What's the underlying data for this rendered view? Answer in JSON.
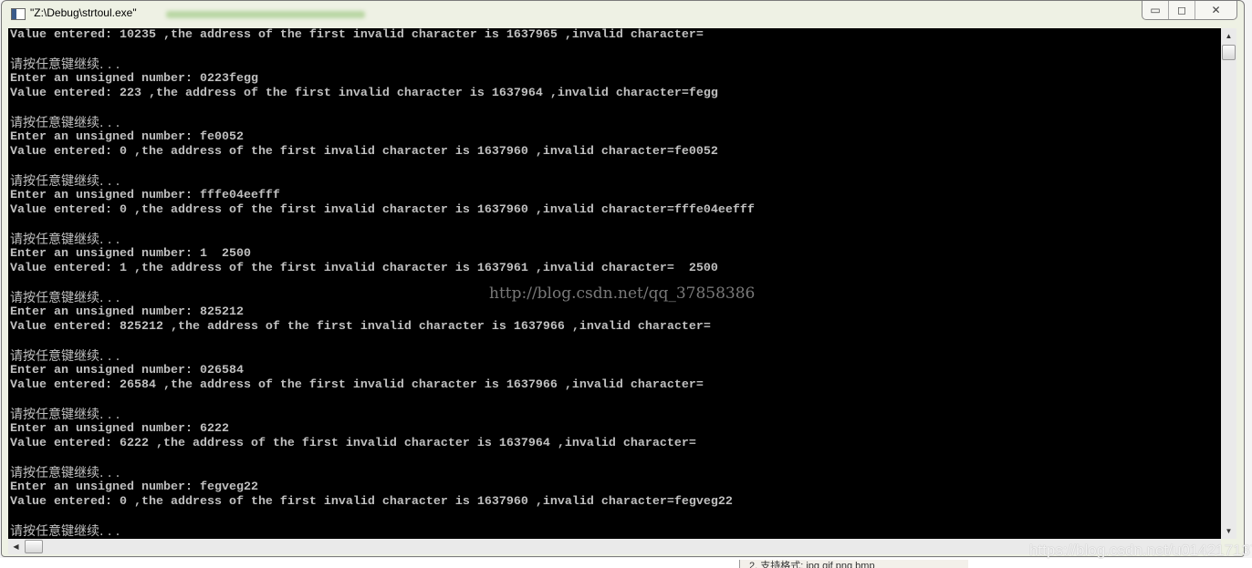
{
  "window": {
    "title": "\"Z:\\Debug\\strtoul.exe\""
  },
  "controls": {
    "minimize": "▭",
    "maximize": "◻",
    "close": "✕"
  },
  "console": {
    "lines": [
      "Value entered: 10235 ,the address of the first invalid character is 1637965 ,invalid character=",
      "",
      "请按任意键继续. . .",
      "Enter an unsigned number: 0223fegg",
      "Value entered: 223 ,the address of the first invalid character is 1637964 ,invalid character=fegg",
      "",
      "请按任意键继续. . .",
      "Enter an unsigned number: fe0052",
      "Value entered: 0 ,the address of the first invalid character is 1637960 ,invalid character=fe0052",
      "",
      "请按任意键继续. . .",
      "Enter an unsigned number: fffe04eefff",
      "Value entered: 0 ,the address of the first invalid character is 1637960 ,invalid character=fffe04eefff",
      "",
      "请按任意键继续. . .",
      "Enter an unsigned number: 1  2500",
      "Value entered: 1 ,the address of the first invalid character is 1637961 ,invalid character=  2500",
      "",
      "请按任意键继续. . .",
      "Enter an unsigned number: 825212",
      "Value entered: 825212 ,the address of the first invalid character is 1637966 ,invalid character=",
      "",
      "请按任意键继续. . .",
      "Enter an unsigned number: 026584",
      "Value entered: 26584 ,the address of the first invalid character is 1637966 ,invalid character=",
      "",
      "请按任意键继续. . .",
      "Enter an unsigned number: 6222",
      "Value entered: 6222 ,the address of the first invalid character is 1637964 ,invalid character=",
      "",
      "请按任意键继续. . .",
      "Enter an unsigned number: fegveg22",
      "Value entered: 0 ,the address of the first invalid character is 1637960 ,invalid character=fegveg22",
      "",
      "请按任意键继续. . ."
    ]
  },
  "watermarks": {
    "center": "http://blog.csdn.net/qq_37858386",
    "corner": "https://blog.csdn.net/u014217137"
  },
  "background_tab": "2. 支持格式: jpg gif png bmp",
  "colors": {
    "console_bg": "#000000",
    "console_text": "#c0c0c0"
  }
}
